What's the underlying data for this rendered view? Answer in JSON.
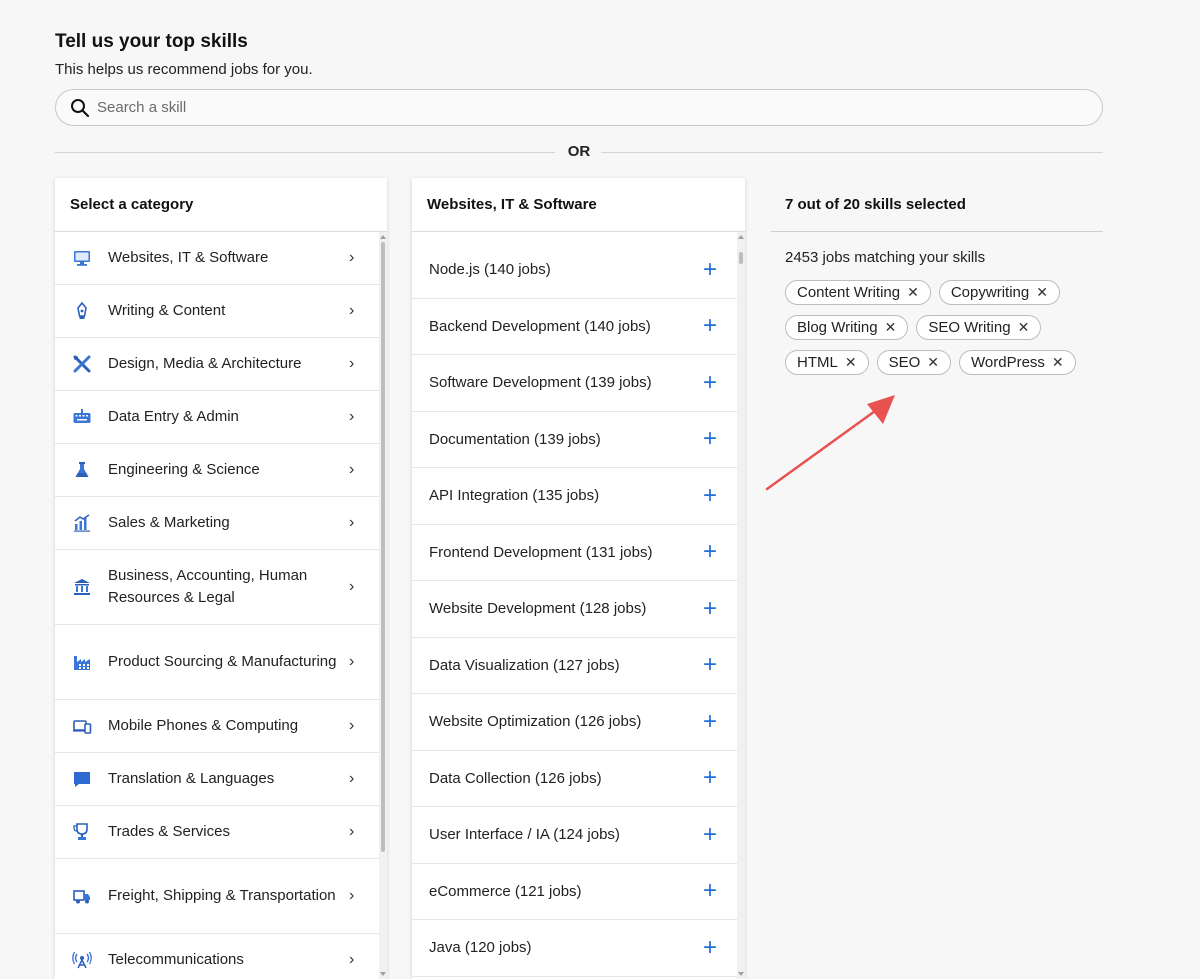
{
  "header": {
    "title": "Tell us your top skills",
    "subtitle": "This helps us recommend jobs for you."
  },
  "search": {
    "placeholder": "Search a skill"
  },
  "divider": {
    "label": "OR"
  },
  "categories": {
    "title": "Select a category",
    "items": [
      {
        "label": "Websites, IT & Software",
        "icon": "monitor-icon"
      },
      {
        "label": "Writing & Content",
        "icon": "pen-nib-icon"
      },
      {
        "label": "Design, Media & Architecture",
        "icon": "design-tools-icon"
      },
      {
        "label": "Data Entry & Admin",
        "icon": "keyboard-icon"
      },
      {
        "label": "Engineering & Science",
        "icon": "flask-icon"
      },
      {
        "label": "Sales & Marketing",
        "icon": "chart-icon"
      },
      {
        "label": "Business, Accounting, Human Resources & Legal",
        "icon": "bank-icon"
      },
      {
        "label": "Product Sourcing & Manufacturing",
        "icon": "factory-icon"
      },
      {
        "label": "Mobile Phones & Computing",
        "icon": "devices-icon"
      },
      {
        "label": "Translation & Languages",
        "icon": "speech-bubble-icon"
      },
      {
        "label": "Trades & Services",
        "icon": "trophy-icon"
      },
      {
        "label": "Freight, Shipping & Transportation",
        "icon": "truck-icon"
      },
      {
        "label": "Telecommunications",
        "icon": "antenna-icon"
      }
    ]
  },
  "skills": {
    "title": "Websites, IT & Software",
    "items": [
      "Node.js (140 jobs)",
      "Backend Development (140 jobs)",
      "Software Development (139 jobs)",
      "Documentation (139 jobs)",
      "API Integration (135 jobs)",
      "Frontend Development (131 jobs)",
      "Website Development (128 jobs)",
      "Data Visualization (127 jobs)",
      "Website Optimization (126 jobs)",
      "Data Collection (126 jobs)",
      "User Interface / IA (124 jobs)",
      "eCommerce (121 jobs)",
      "Java (120 jobs)"
    ]
  },
  "selected": {
    "title": "7 out of 20 skills selected",
    "matching": "2453 jobs matching your skills",
    "chips": [
      "Content Writing",
      "Copywriting",
      "Blog Writing",
      "SEO Writing",
      "HTML",
      "SEO",
      "WordPress"
    ]
  },
  "colors": {
    "accent": "#1f6fd6",
    "annotation_arrow": "#e8524f"
  }
}
